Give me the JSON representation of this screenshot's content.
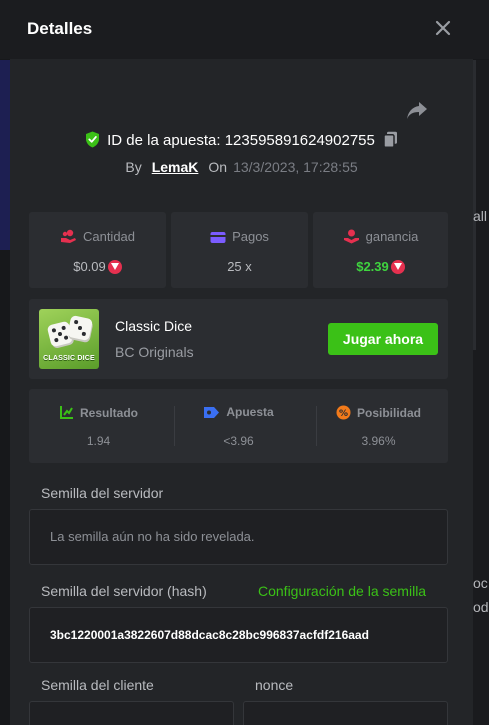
{
  "modal": {
    "title": "Detalles"
  },
  "bet": {
    "id_label": "ID de la apuesta: 123595891624902755",
    "by_label": "By",
    "user": "LemaK",
    "on_label": "On",
    "date": "13/3/2023, 17:28:55"
  },
  "stats": {
    "amount": {
      "label": "Cantidad",
      "value": "$0.09"
    },
    "payout": {
      "label": "Pagos",
      "value": "25 x"
    },
    "profit": {
      "label": "ganancia",
      "value": "$2.39"
    }
  },
  "game": {
    "name": "Classic Dice",
    "provider": "BC Originals",
    "thumb_caption": "CLASSIC DICE",
    "play_label": "Jugar ahora"
  },
  "result": {
    "result": {
      "label": "Resultado",
      "value": "1.94"
    },
    "bet": {
      "label": "Apuesta",
      "value": "<3.96"
    },
    "chance": {
      "label": "Posibilidad",
      "value": "3.96%"
    }
  },
  "seeds": {
    "server_seed_label": "Semilla del servidor",
    "server_seed_value": "La semilla aún no ha sido revelada.",
    "server_hash_label": "Semilla del servidor (hash)",
    "seed_config_link": "Configuración de la semilla",
    "server_hash_value": "3bc1220001a3822607d88dcac8c28bc996837acfdf216aad",
    "client_seed_label": "Semilla del cliente",
    "nonce_label": "nonce"
  },
  "background": {
    "right_text_1": "all",
    "right_text_2": "oc",
    "right_text_3": "ode"
  },
  "colors": {
    "accent_green": "#3bc117",
    "profit_green": "#3fd43f",
    "trx_red": "#e5304f",
    "modal_bg": "#232528",
    "card_bg": "#2b2d31"
  }
}
